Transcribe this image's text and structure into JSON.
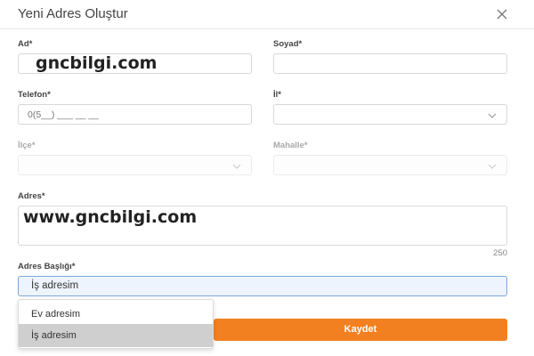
{
  "dialog": {
    "title": "Yeni Adres Oluştur",
    "close_icon": "close-icon"
  },
  "form": {
    "ad": {
      "label": "Ad*",
      "value": ""
    },
    "soyad": {
      "label": "Soyad*",
      "value": ""
    },
    "telefon": {
      "label": "Telefon*",
      "placeholder": "0(5__) ___ __ __"
    },
    "il": {
      "label": "İl*",
      "value": "",
      "icon": "chevron-down-icon"
    },
    "ilce": {
      "label": "İlçe*",
      "value": "",
      "disabled": true,
      "icon": "chevron-down-icon"
    },
    "mahalle": {
      "label": "Mahalle*",
      "value": "",
      "disabled": true,
      "icon": "chevron-down-icon"
    },
    "adres": {
      "label": "Adres*",
      "value": "",
      "counter": "250"
    },
    "adres_basligi": {
      "label": "Adres Başlığı*",
      "value": "İş adresim",
      "options": [
        "Ev adresim",
        "İş adresim"
      ],
      "selected": "İş adresim"
    }
  },
  "watermarks": [
    "gncbilgi.com",
    "www.gncbilgi.com"
  ],
  "actions": {
    "save_label": "Kaydet"
  },
  "colors": {
    "accent": "#f28021",
    "focus_border": "#7aa7d9",
    "focus_bg": "#eef4fd",
    "selected_option": "#cfcfcf"
  }
}
